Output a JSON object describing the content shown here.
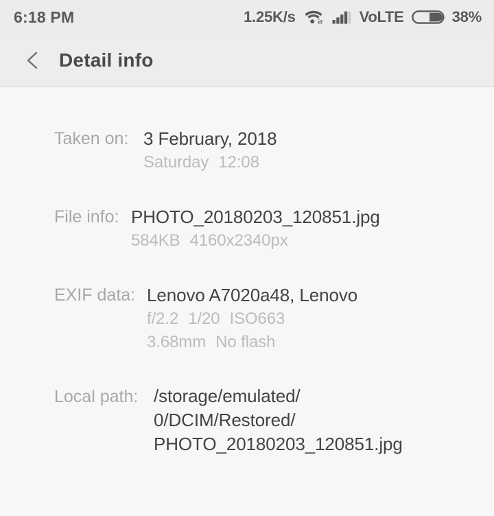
{
  "status_bar": {
    "time": "6:18 PM",
    "network_speed": "1.25K/s",
    "wifi_icon": "wifi-icon",
    "signal_icon": "cellular-signal-icon",
    "volte_label": "VoLTE",
    "battery_icon": "battery-icon",
    "battery_percent": "38%",
    "background_color": "#ececec",
    "text_color": "#5a5a5a"
  },
  "app_bar": {
    "back_icon": "chevron-left-icon",
    "title": "Detail info",
    "background_color": "#ededed",
    "divider_color": "#dcdcdc"
  },
  "content": {
    "background_color": "#f7f7f7",
    "label_color": "#a8a8a8",
    "primary_value_color": "#434343",
    "secondary_value_color": "#bcbcbc",
    "rows": [
      {
        "label": "Taken on:",
        "primary": "3 February, 2018",
        "secondary_a": "Saturday",
        "secondary_b": "12:08"
      },
      {
        "label": "File info:",
        "primary": "PHOTO_20180203_120851.jpg",
        "secondary_a": "584KB",
        "secondary_b": "4160x2340px"
      },
      {
        "label": "EXIF data:",
        "primary": "Lenovo A7020a48, Lenovo",
        "secondary_line1_a": "f/2.2",
        "secondary_line1_b": "1/20",
        "secondary_line1_c": "ISO663",
        "secondary_line2_a": "3.68mm",
        "secondary_line2_b": "No flash"
      },
      {
        "label": "Local path:",
        "path_line1": "/storage/emulated/",
        "path_line2": "0/DCIM/Restored/",
        "path_line3": "PHOTO_20180203_120851.jpg"
      }
    ]
  }
}
